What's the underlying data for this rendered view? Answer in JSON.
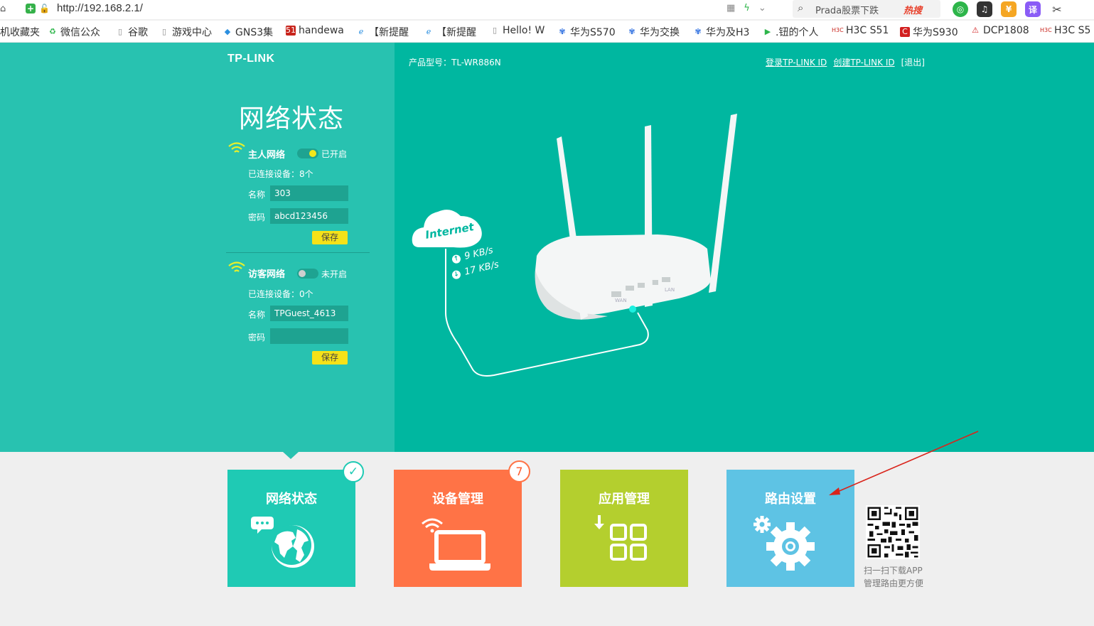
{
  "browser": {
    "url_host": "http://192.168.2.1",
    "url_tail": "/",
    "search_text": "Prada股票下跌",
    "hot_label": "热搜",
    "translate_label": "译"
  },
  "bookmarks": [
    {
      "icon": "",
      "label": "机收藏夹"
    },
    {
      "icon": "wechat-icon",
      "label": "微信公众"
    },
    {
      "icon": "page-icon",
      "label": "谷歌"
    },
    {
      "icon": "page-icon",
      "label": "游戏中心"
    },
    {
      "icon": "gns3-icon",
      "label": "GNS3集"
    },
    {
      "icon": "51-icon",
      "label": "handewa"
    },
    {
      "icon": "ie-icon",
      "label": "【新提醒"
    },
    {
      "icon": "ie-icon",
      "label": "【新提醒"
    },
    {
      "icon": "page-icon",
      "label": "Hello! W"
    },
    {
      "icon": "paw-icon",
      "label": "华为S570"
    },
    {
      "icon": "paw-icon",
      "label": "华为交换"
    },
    {
      "icon": "paw-icon",
      "label": "华为及H3"
    },
    {
      "icon": "play-icon",
      "label": ".钮的个人"
    },
    {
      "icon": "h3c-icon",
      "label": "H3C S51"
    },
    {
      "icon": "c-icon",
      "label": "华为S930"
    },
    {
      "icon": "warn-icon",
      "label": "DCP1808"
    },
    {
      "icon": "h3c-icon",
      "label": "H3C S5"
    }
  ],
  "header": {
    "logo": "TP-LINK",
    "model": "产品型号：TL-WR886N",
    "login_link": "登录TP-LINK ID",
    "create_link": "创建TP-LINK ID",
    "logout_link": "[退出]"
  },
  "status": {
    "title": "网络状态",
    "host": {
      "title": "主人网络",
      "toggle_state": "已开启",
      "enabled": true,
      "connected": "已连接设备：8个",
      "name_label": "名称",
      "name_value": "303",
      "password_label": "密码",
      "password_value": "abcd123456",
      "save": "保存"
    },
    "guest": {
      "title": "访客网络",
      "toggle_state": "未开启",
      "enabled": false,
      "connected": "已连接设备：0个",
      "name_label": "名称",
      "name_value": "TPGuest_4613",
      "password_label": "密码",
      "password_value": "",
      "save": "保存"
    }
  },
  "internet": {
    "label": "Internet",
    "upload": "9 KB/s",
    "download": "17 KB/s",
    "wan_port": "WAN",
    "lan_port": "LAN"
  },
  "tiles": [
    {
      "label": "网络状态",
      "color": "#1fcab4",
      "icon": "globe-icon",
      "badge": "✓"
    },
    {
      "label": "设备管理",
      "color": "#ff7346",
      "icon": "laptop-wifi-icon",
      "badge": "7"
    },
    {
      "label": "应用管理",
      "color": "#b4cf2e",
      "icon": "apps-grid-icon",
      "badge": ""
    },
    {
      "label": "路由设置",
      "color": "#5ec3e4",
      "icon": "gear-icon",
      "badge": ""
    }
  ],
  "qr": {
    "caption_line1": "扫一扫下载APP",
    "caption_line2": "管理路由更方便"
  },
  "colors": {
    "left_panel": "#28c2b0",
    "main_panel": "#00b7a0",
    "accent_yellow": "#f5e218",
    "annotation_arrow": "#d9241b"
  }
}
